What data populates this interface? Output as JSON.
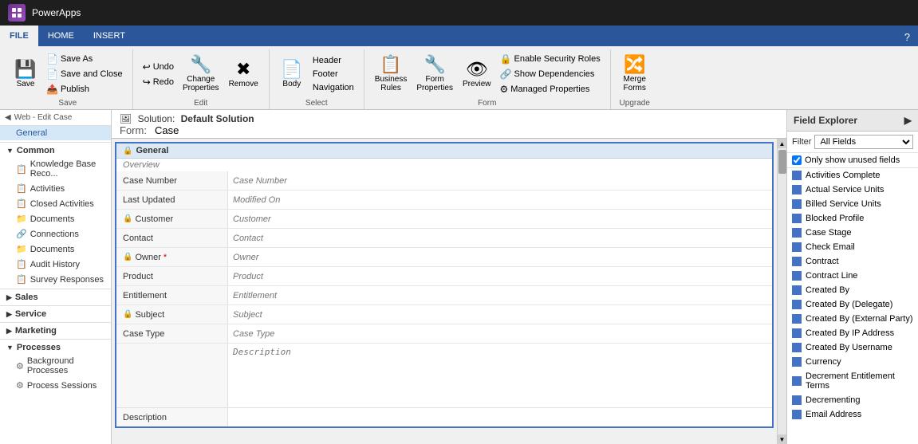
{
  "app": {
    "name": "PowerApps"
  },
  "ribbon_tabs": [
    {
      "label": "FILE",
      "active": true
    },
    {
      "label": "HOME",
      "active": false
    },
    {
      "label": "INSERT",
      "active": false
    }
  ],
  "ribbon": {
    "save_group": {
      "label": "Save",
      "buttons": [
        {
          "id": "save",
          "icon": "💾",
          "label": "Save"
        },
        {
          "id": "save-as",
          "icon": "",
          "label": "Save As"
        },
        {
          "id": "save-close",
          "icon": "",
          "label": "Save and Close"
        },
        {
          "id": "publish",
          "icon": "",
          "label": "Publish"
        }
      ]
    },
    "edit_group": {
      "label": "Edit",
      "buttons": [
        {
          "id": "undo",
          "label": "Undo"
        },
        {
          "id": "redo",
          "label": "Redo"
        },
        {
          "id": "change-props",
          "icon": "",
          "label": "Change\nProperties"
        },
        {
          "id": "remove",
          "label": "Remove"
        }
      ]
    },
    "select_group": {
      "label": "Select",
      "buttons": [
        {
          "id": "body",
          "icon": "",
          "label": "Body"
        },
        {
          "id": "header",
          "label": "Header"
        },
        {
          "id": "footer",
          "label": "Footer"
        },
        {
          "id": "navigation",
          "label": "Navigation"
        }
      ]
    },
    "form_group": {
      "label": "Form",
      "buttons": [
        {
          "id": "business-rules",
          "icon": "",
          "label": "Business\nRules"
        },
        {
          "id": "form-props",
          "icon": "",
          "label": "Form\nProperties"
        },
        {
          "id": "preview",
          "icon": "",
          "label": "Preview"
        },
        {
          "id": "enable-security",
          "label": "Enable Security Roles"
        },
        {
          "id": "show-deps",
          "label": "Show Dependencies"
        },
        {
          "id": "managed-props",
          "label": "Managed Properties"
        }
      ]
    },
    "upgrade_group": {
      "label": "Upgrade",
      "buttons": [
        {
          "id": "merge-forms",
          "icon": "",
          "label": "Merge\nForms"
        }
      ]
    }
  },
  "breadcrumb": {
    "web_edit": "Web - Edit Case",
    "general": "General"
  },
  "sidebar": {
    "sections": [
      {
        "id": "common",
        "label": "Common",
        "expanded": true,
        "items": [
          {
            "label": "Knowledge Base Reco...",
            "icon": "📋"
          },
          {
            "label": "Activities",
            "icon": "📋"
          },
          {
            "label": "Closed Activities",
            "icon": "📋"
          },
          {
            "label": "Documents",
            "icon": "📁"
          },
          {
            "label": "Connections",
            "icon": "🔗"
          },
          {
            "label": "Documents",
            "icon": "📁"
          },
          {
            "label": "Audit History",
            "icon": "📋"
          },
          {
            "label": "Survey Responses",
            "icon": "📋"
          }
        ]
      },
      {
        "id": "sales",
        "label": "Sales",
        "expanded": false,
        "items": []
      },
      {
        "id": "service",
        "label": "Service",
        "expanded": false,
        "items": []
      },
      {
        "id": "marketing",
        "label": "Marketing",
        "expanded": false,
        "items": []
      },
      {
        "id": "processes",
        "label": "Processes",
        "expanded": true,
        "items": [
          {
            "label": "Background Processes",
            "icon": "⚙"
          },
          {
            "label": "Process Sessions",
            "icon": "⚙"
          }
        ]
      }
    ]
  },
  "solution": {
    "label": "Solution:",
    "name": "Default Solution",
    "form_label": "Form:",
    "form_name": "Case"
  },
  "form": {
    "section_label": "General",
    "subsection_label": "Overview",
    "fields": [
      {
        "label": "Case Number",
        "placeholder": "Case Number",
        "required": false,
        "icon": false
      },
      {
        "label": "Last Updated",
        "placeholder": "Modified On",
        "required": false,
        "icon": false
      },
      {
        "label": "Customer",
        "placeholder": "Customer",
        "required": false,
        "icon": true
      },
      {
        "label": "Contact",
        "placeholder": "Contact",
        "required": false,
        "icon": false
      },
      {
        "label": "Owner",
        "placeholder": "Owner",
        "required": true,
        "icon": true
      },
      {
        "label": "Product",
        "placeholder": "Product",
        "required": false,
        "icon": false
      },
      {
        "label": "Entitlement",
        "placeholder": "Entitlement",
        "required": false,
        "icon": false
      },
      {
        "label": "Subject",
        "placeholder": "Subject",
        "required": false,
        "icon": true
      },
      {
        "label": "Case Type",
        "placeholder": "Case Type",
        "required": false,
        "icon": false
      },
      {
        "label": "Description",
        "placeholder": "Description",
        "required": false,
        "icon": false,
        "textarea": true
      }
    ]
  },
  "field_explorer": {
    "title": "Field Explorer",
    "filter_label": "Filter",
    "filter_option": "All Fields",
    "checkbox_label": "Only show unused fields",
    "fields": [
      "Activities Complete",
      "Actual Service Units",
      "Billed Service Units",
      "Blocked Profile",
      "Case Stage",
      "Check Email",
      "Contract",
      "Contract Line",
      "Created By",
      "Created By (Delegate)",
      "Created By (External Party)",
      "Created By IP Address",
      "Created By Username",
      "Currency",
      "Decrement Entitlement Terms",
      "Decrementing",
      "Email Address"
    ]
  }
}
